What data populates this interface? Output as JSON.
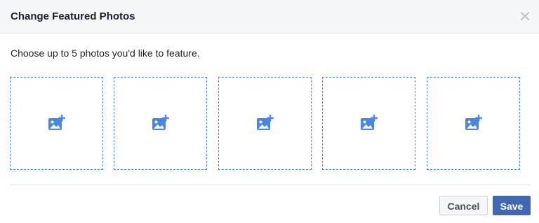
{
  "dialog": {
    "title": "Change Featured Photos",
    "close_icon": "close-icon",
    "prompt": "Choose up to 5 photos you'd like to feature.",
    "slots": [
      {
        "icon": "add-photo-icon"
      },
      {
        "icon": "add-photo-icon"
      },
      {
        "icon": "add-photo-icon"
      },
      {
        "icon": "add-photo-icon"
      },
      {
        "icon": "add-photo-icon"
      }
    ],
    "cancel_label": "Cancel",
    "save_label": "Save"
  },
  "colors": {
    "accent": "#4267b2",
    "slot_border": "#4a86e8",
    "icon": "#4a86e8",
    "header_bg": "#f5f6f7"
  }
}
